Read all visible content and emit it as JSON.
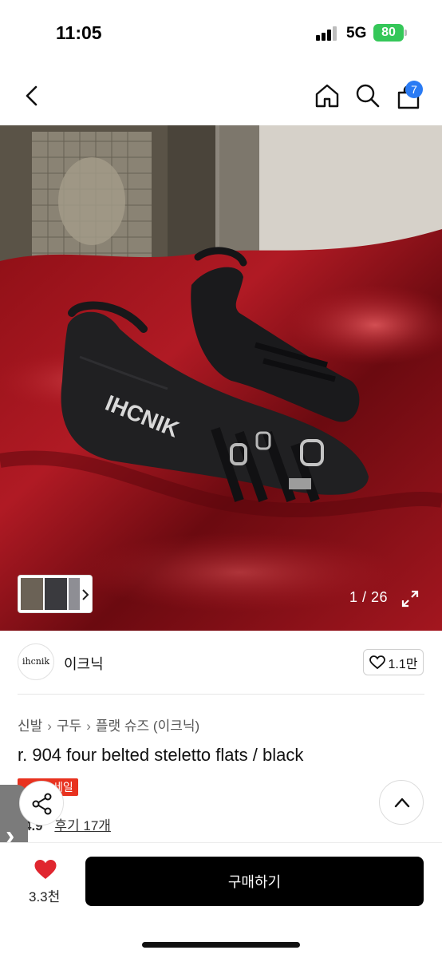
{
  "status_bar": {
    "time": "11:05",
    "network": "5G",
    "battery": "80"
  },
  "nav": {
    "back_icon": "chevron-left-icon",
    "home_icon": "home-icon",
    "search_icon": "search-icon",
    "cart_icon": "shopping-bag-icon",
    "cart_count": "7"
  },
  "gallery": {
    "counter": "1 / 26",
    "expand_icon": "expand-icon"
  },
  "brand": {
    "logo_text": "ihcnik",
    "name": "이크닉",
    "likes": "1.1만"
  },
  "breadcrumb": [
    "신발",
    "구두",
    "플랫 슈즈 (이크닉)"
  ],
  "product": {
    "title": "r. 904 four belted steletto flats / black",
    "sale_badge": "세일",
    "rating": "4.9",
    "reviews": "후기 17개"
  },
  "bottom_bar": {
    "wish_count": "3.3천",
    "buy_label": "구매하기"
  },
  "colors": {
    "accent_blue": "#2a7bf4",
    "sale_red": "#e8321f",
    "battery_green": "#35c759",
    "buy_button": "#000000"
  }
}
